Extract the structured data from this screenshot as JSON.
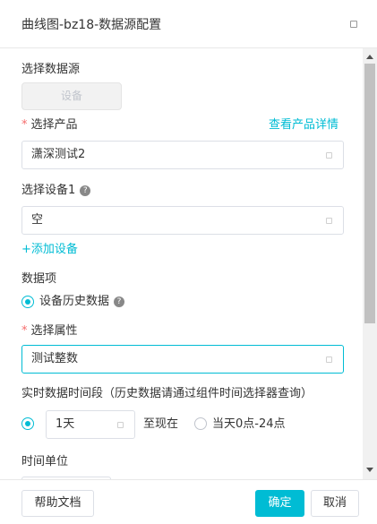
{
  "header": {
    "title": "曲线图-bz18-数据源配置"
  },
  "form": {
    "datasource_label": "选择数据源",
    "datasource_button": "设备",
    "product_label": "选择产品",
    "product_detail_link": "查看产品详情",
    "product_value": "潇深测试2",
    "device_label": "选择设备1",
    "device_value": "空",
    "add_device_link": "+添加设备",
    "data_item_label": "数据项",
    "data_item_option": "设备历史数据",
    "attribute_label": "选择属性",
    "attribute_value": "测试整数",
    "time_range_label": "实时数据时间段（历史数据请通过组件时间选择器查询）",
    "time_range_value": "1天",
    "time_range_suffix": "至现在",
    "time_range_alt": "当天0点-24点",
    "time_unit_label": "时间单位",
    "required_mark": "*",
    "help_glyph": "?"
  },
  "footer": {
    "help_docs": "帮助文档",
    "confirm": "确定",
    "cancel": "取消"
  },
  "colors": {
    "accent": "#00bcd4",
    "required": "#f56c6c"
  }
}
